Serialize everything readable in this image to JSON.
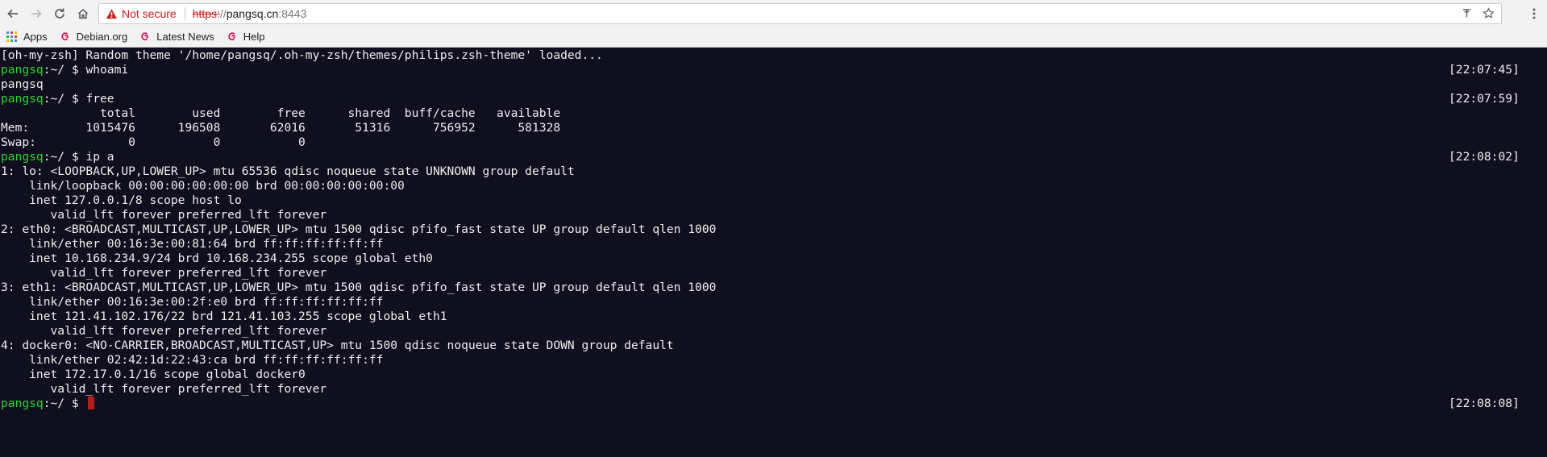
{
  "browser": {
    "security_label": "Not secure",
    "url_scheme": "https:",
    "url_slashes": "//",
    "url_host": "pangsq.cn",
    "url_port": ":8443",
    "bookmarks": [
      "Apps",
      "Debian.org",
      "Latest News",
      "Help"
    ]
  },
  "terminal": {
    "lines": [
      {
        "text": "[oh-my-zsh] Random theme '/home/pangsq/.oh-my-zsh/themes/philips.zsh-theme' loaded..."
      },
      {
        "user": "pangsq",
        "path": ":~/ $ ",
        "cmd": "whoami",
        "ts": "[22:07:45]"
      },
      {
        "text": "pangsq"
      },
      {
        "user": "pangsq",
        "path": ":~/ $ ",
        "cmd": "free",
        "ts": "[22:07:59]"
      },
      {
        "text": "              total        used        free      shared  buff/cache   available"
      },
      {
        "text": "Mem:        1015476      196508       62016       51316      756952      581328"
      },
      {
        "text": "Swap:             0           0           0"
      },
      {
        "user": "pangsq",
        "path": ":~/ $ ",
        "cmd": "ip a",
        "ts": "[22:08:02]"
      },
      {
        "text": "1: lo: <LOOPBACK,UP,LOWER_UP> mtu 65536 qdisc noqueue state UNKNOWN group default"
      },
      {
        "text": "    link/loopback 00:00:00:00:00:00 brd 00:00:00:00:00:00"
      },
      {
        "text": "    inet 127.0.0.1/8 scope host lo"
      },
      {
        "text": "       valid_lft forever preferred_lft forever"
      },
      {
        "text": "2: eth0: <BROADCAST,MULTICAST,UP,LOWER_UP> mtu 1500 qdisc pfifo_fast state UP group default qlen 1000"
      },
      {
        "text": "    link/ether 00:16:3e:00:81:64 brd ff:ff:ff:ff:ff:ff"
      },
      {
        "text": "    inet 10.168.234.9/24 brd 10.168.234.255 scope global eth0"
      },
      {
        "text": "       valid_lft forever preferred_lft forever"
      },
      {
        "text": "3: eth1: <BROADCAST,MULTICAST,UP,LOWER_UP> mtu 1500 qdisc pfifo_fast state UP group default qlen 1000"
      },
      {
        "text": "    link/ether 00:16:3e:00:2f:e0 brd ff:ff:ff:ff:ff:ff"
      },
      {
        "text": "    inet 121.41.102.176/22 brd 121.41.103.255 scope global eth1"
      },
      {
        "text": "       valid_lft forever preferred_lft forever"
      },
      {
        "text": "4: docker0: <NO-CARRIER,BROADCAST,MULTICAST,UP> mtu 1500 qdisc noqueue state DOWN group default"
      },
      {
        "text": "    link/ether 02:42:1d:22:43:ca brd ff:ff:ff:ff:ff:ff"
      },
      {
        "text": "    inet 172.17.0.1/16 scope global docker0"
      },
      {
        "text": "       valid_lft forever preferred_lft forever"
      },
      {
        "user": "pangsq",
        "path": ":~/ $ ",
        "cmd": "",
        "ts": "[22:08:08]",
        "cursor": true
      }
    ]
  },
  "colors": {
    "terminal_bg": "#0f0f1e",
    "prompt_user": "#2fd32f",
    "cursor": "#b21d1d",
    "insecure_red": "#c5221f"
  }
}
